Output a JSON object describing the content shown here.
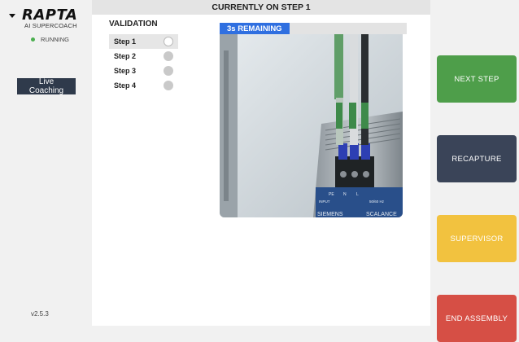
{
  "sidebar": {
    "logo": "RAPTA",
    "tagline": "AI SUPERCOACH",
    "status": "RUNNING",
    "coaching_button": "Live Coaching",
    "version": "v2.5.3"
  },
  "header": {
    "title": "CURRENTLY ON STEP 1"
  },
  "validation": {
    "title": "VALIDATION",
    "steps": [
      {
        "label": "Step 1",
        "state": "current"
      },
      {
        "label": "Step 2",
        "state": "pending"
      },
      {
        "label": "Step 3",
        "state": "pending"
      },
      {
        "label": "Step 4",
        "state": "pending"
      }
    ]
  },
  "camera": {
    "remaining": "3s REMAINING",
    "terminal_labels": {
      "pe": "PE",
      "n": "N",
      "l": "L"
    },
    "rating": "50/60 Hz",
    "input_label": "INPUT",
    "brand": "SIEMENS",
    "model": "SCALANCE"
  },
  "actions": {
    "next": "NEXT STEP",
    "recapture": "RECAPTURE",
    "supervisor": "SUPERVISOR",
    "end": "END ASSEMBLY"
  },
  "colors": {
    "next": "#4e9e4a",
    "recapture": "#3a4458",
    "supervisor": "#f2c23f",
    "end": "#d64f45",
    "badge": "#2f6fe0",
    "status_dot": "#4caf50"
  }
}
